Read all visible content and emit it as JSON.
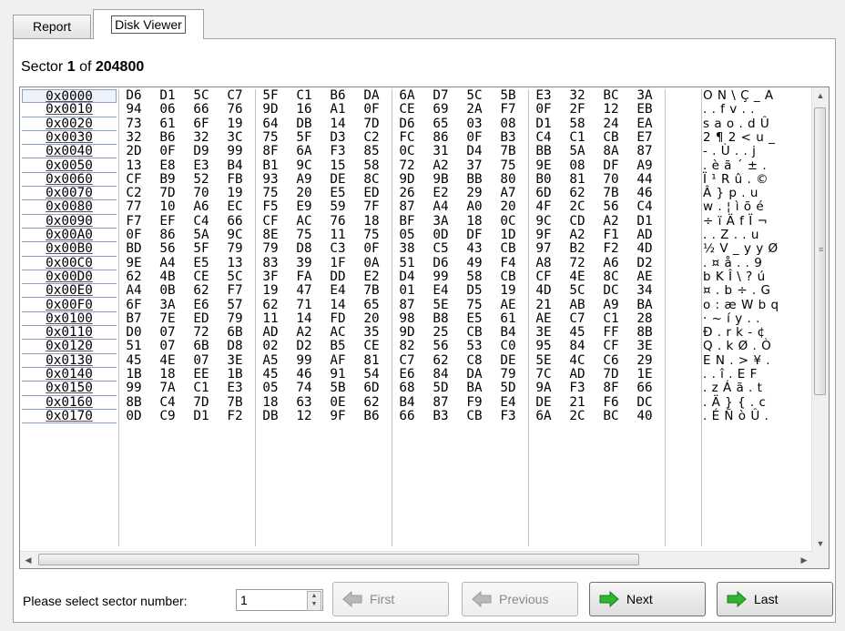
{
  "tabs": {
    "report": "Report",
    "disk_viewer": "Disk Viewer"
  },
  "sector": {
    "prefix": "Sector",
    "current": "1",
    "of": "of",
    "total": "204800"
  },
  "footer": {
    "label": "Please select sector number:",
    "sector_value": "1",
    "first": "First",
    "previous": "Previous",
    "next": "Next",
    "last": "Last"
  },
  "colors": {
    "arrow_green": "#2fb52f",
    "arrow_disabled": "#b9b9b9",
    "address_border": "#8aa0c0"
  },
  "hex_rows": [
    {
      "addr": "0x0000",
      "bytes": [
        "D6",
        "D1",
        "5C",
        "C7",
        "5F",
        "C1",
        "B6",
        "DA",
        "6A",
        "D7",
        "5C",
        "5B",
        "E3",
        "32",
        "BC",
        "3A"
      ],
      "ascii": "OÑ\\Ç_Á"
    },
    {
      "addr": "0x0010",
      "bytes": [
        "94",
        "06",
        "66",
        "76",
        "9D",
        "16",
        "A1",
        "0F",
        "CE",
        "69",
        "2A",
        "F7",
        "0F",
        "2F",
        "12",
        "EB"
      ],
      "ascii": "..fv.."
    },
    {
      "addr": "0x0020",
      "bytes": [
        "73",
        "61",
        "6F",
        "19",
        "64",
        "DB",
        "14",
        "7D",
        "D6",
        "65",
        "03",
        "08",
        "D1",
        "58",
        "24",
        "EA"
      ],
      "ascii": "sao.dÛ"
    },
    {
      "addr": "0x0030",
      "bytes": [
        "32",
        "B6",
        "32",
        "3C",
        "75",
        "5F",
        "D3",
        "C2",
        "FC",
        "86",
        "0F",
        "B3",
        "C4",
        "C1",
        "CB",
        "E7"
      ],
      "ascii": "2¶2<u_"
    },
    {
      "addr": "0x0040",
      "bytes": [
        "2D",
        "0F",
        "D9",
        "99",
        "8F",
        "6A",
        "F3",
        "85",
        "0C",
        "31",
        "D4",
        "7B",
        "BB",
        "5A",
        "8A",
        "87"
      ],
      "ascii": "-.Ù..j"
    },
    {
      "addr": "0x0050",
      "bytes": [
        "13",
        "E8",
        "E3",
        "B4",
        "B1",
        "9C",
        "15",
        "58",
        "72",
        "A2",
        "37",
        "75",
        "9E",
        "08",
        "DF",
        "A9"
      ],
      "ascii": ".èã´±."
    },
    {
      "addr": "0x0060",
      "bytes": [
        "CF",
        "B9",
        "52",
        "FB",
        "93",
        "A9",
        "DE",
        "8C",
        "9D",
        "9B",
        "BB",
        "80",
        "B0",
        "81",
        "70",
        "44"
      ],
      "ascii": "Ï¹Rû.©"
    },
    {
      "addr": "0x0070",
      "bytes": [
        "C2",
        "7D",
        "70",
        "19",
        "75",
        "20",
        "E5",
        "ED",
        "26",
        "E2",
        "29",
        "A7",
        "6D",
        "62",
        "7B",
        "46"
      ],
      "ascii": "Â}p.u "
    },
    {
      "addr": "0x0080",
      "bytes": [
        "77",
        "10",
        "A6",
        "EC",
        "F5",
        "E9",
        "59",
        "7F",
        "87",
        "A4",
        "A0",
        "20",
        "4F",
        "2C",
        "56",
        "C4"
      ],
      "ascii": "w.¦ìõé"
    },
    {
      "addr": "0x0090",
      "bytes": [
        "F7",
        "EF",
        "C4",
        "66",
        "CF",
        "AC",
        "76",
        "18",
        "BF",
        "3A",
        "18",
        "0C",
        "9C",
        "CD",
        "A2",
        "D1"
      ],
      "ascii": "÷ïÄfÏ¬"
    },
    {
      "addr": "0x00A0",
      "bytes": [
        "0F",
        "86",
        "5A",
        "9C",
        "8E",
        "75",
        "11",
        "75",
        "05",
        "0D",
        "DF",
        "1D",
        "9F",
        "A2",
        "F1",
        "AD"
      ],
      "ascii": "..Z..u"
    },
    {
      "addr": "0x00B0",
      "bytes": [
        "BD",
        "56",
        "5F",
        "79",
        "79",
        "D8",
        "C3",
        "0F",
        "38",
        "C5",
        "43",
        "CB",
        "97",
        "B2",
        "F2",
        "4D"
      ],
      "ascii": "½V_yyØ"
    },
    {
      "addr": "0x00C0",
      "bytes": [
        "9E",
        "A4",
        "E5",
        "13",
        "83",
        "39",
        "1F",
        "0A",
        "51",
        "D6",
        "49",
        "F4",
        "A8",
        "72",
        "A6",
        "D2"
      ],
      "ascii": ".¤å..9"
    },
    {
      "addr": "0x00D0",
      "bytes": [
        "62",
        "4B",
        "CE",
        "5C",
        "3F",
        "FA",
        "DD",
        "E2",
        "D4",
        "99",
        "58",
        "CB",
        "CF",
        "4E",
        "8C",
        "AE"
      ],
      "ascii": "bKÎ\\?ú"
    },
    {
      "addr": "0x00E0",
      "bytes": [
        "A4",
        "0B",
        "62",
        "F7",
        "19",
        "47",
        "E4",
        "7B",
        "01",
        "E4",
        "D5",
        "19",
        "4D",
        "5C",
        "DC",
        "34"
      ],
      "ascii": "¤.b÷.G"
    },
    {
      "addr": "0x00F0",
      "bytes": [
        "6F",
        "3A",
        "E6",
        "57",
        "62",
        "71",
        "14",
        "65",
        "87",
        "5E",
        "75",
        "AE",
        "21",
        "AB",
        "A9",
        "BA"
      ],
      "ascii": "o:æWbq"
    },
    {
      "addr": "0x0100",
      "bytes": [
        "B7",
        "7E",
        "ED",
        "79",
        "11",
        "14",
        "FD",
        "20",
        "98",
        "B8",
        "E5",
        "61",
        "AE",
        "C7",
        "C1",
        "28"
      ],
      "ascii": "·~íy.."
    },
    {
      "addr": "0x0110",
      "bytes": [
        "D0",
        "07",
        "72",
        "6B",
        "AD",
        "A2",
        "AC",
        "35",
        "9D",
        "25",
        "CB",
        "B4",
        "3E",
        "45",
        "FF",
        "8B"
      ],
      "ascii": "Ð.rk-¢"
    },
    {
      "addr": "0x0120",
      "bytes": [
        "51",
        "07",
        "6B",
        "D8",
        "02",
        "D2",
        "B5",
        "CE",
        "82",
        "56",
        "53",
        "C0",
        "95",
        "84",
        "CF",
        "3E"
      ],
      "ascii": "Q.kØ.Ò"
    },
    {
      "addr": "0x0130",
      "bytes": [
        "45",
        "4E",
        "07",
        "3E",
        "A5",
        "99",
        "AF",
        "81",
        "C7",
        "62",
        "C8",
        "DE",
        "5E",
        "4C",
        "C6",
        "29"
      ],
      "ascii": "EN.>¥."
    },
    {
      "addr": "0x0140",
      "bytes": [
        "1B",
        "18",
        "EE",
        "1B",
        "45",
        "46",
        "91",
        "54",
        "E6",
        "84",
        "DA",
        "79",
        "7C",
        "AD",
        "7D",
        "1E"
      ],
      "ascii": "..î.EF"
    },
    {
      "addr": "0x0150",
      "bytes": [
        "99",
        "7A",
        "C1",
        "E3",
        "05",
        "74",
        "5B",
        "6D",
        "68",
        "5D",
        "BA",
        "5D",
        "9A",
        "F3",
        "8F",
        "66"
      ],
      "ascii": ".zÁã.t"
    },
    {
      "addr": "0x0160",
      "bytes": [
        "8B",
        "C4",
        "7D",
        "7B",
        "18",
        "63",
        "0E",
        "62",
        "B4",
        "87",
        "F9",
        "E4",
        "DE",
        "21",
        "F6",
        "DC"
      ],
      "ascii": ".Ä}{.c"
    },
    {
      "addr": "0x0170",
      "bytes": [
        "0D",
        "C9",
        "D1",
        "F2",
        "DB",
        "12",
        "9F",
        "B6",
        "66",
        "B3",
        "CB",
        "F3",
        "6A",
        "2C",
        "BC",
        "40"
      ],
      "ascii": ".ÉÑòÛ."
    }
  ]
}
